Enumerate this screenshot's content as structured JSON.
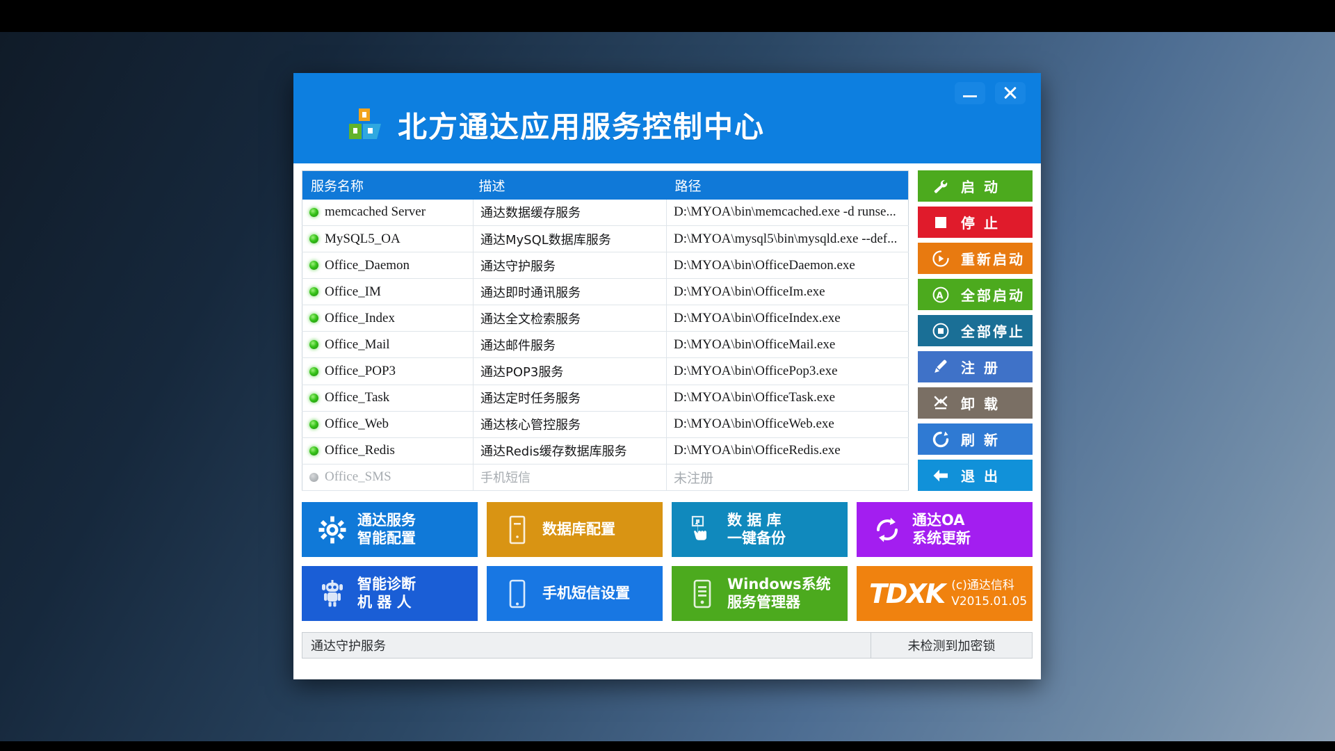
{
  "window": {
    "title": "北方通达应用服务控制中心",
    "logo_icon": "app-blocks-logo",
    "minimize_icon": "minimize-icon",
    "close_icon": "close-icon",
    "titlebar_color": "#0d7fe0"
  },
  "table": {
    "columns": [
      "服务名称",
      "描述",
      "路径"
    ],
    "rows": [
      {
        "status_icon": "status-led-on",
        "name": "memcached Server",
        "desc": "通达数据缓存服务",
        "path": "D:\\MYOA\\bin\\memcached.exe -d runse...",
        "enabled": true
      },
      {
        "status_icon": "status-led-on",
        "name": "MySQL5_OA",
        "desc": "通达MySQL数据库服务",
        "path": "D:\\MYOA\\mysql5\\bin\\mysqld.exe --def...",
        "enabled": true
      },
      {
        "status_icon": "status-led-on",
        "name": "Office_Daemon",
        "desc": "通达守护服务",
        "path": "D:\\MYOA\\bin\\OfficeDaemon.exe",
        "enabled": true
      },
      {
        "status_icon": "status-led-on",
        "name": "Office_IM",
        "desc": "通达即时通讯服务",
        "path": "D:\\MYOA\\bin\\OfficeIm.exe",
        "enabled": true
      },
      {
        "status_icon": "status-led-on",
        "name": "Office_Index",
        "desc": "通达全文检索服务",
        "path": "D:\\MYOA\\bin\\OfficeIndex.exe",
        "enabled": true
      },
      {
        "status_icon": "status-led-on",
        "name": "Office_Mail",
        "desc": "通达邮件服务",
        "path": "D:\\MYOA\\bin\\OfficeMail.exe",
        "enabled": true
      },
      {
        "status_icon": "status-led-on",
        "name": "Office_POP3",
        "desc": "通达POP3服务",
        "path": "D:\\MYOA\\bin\\OfficePop3.exe",
        "enabled": true
      },
      {
        "status_icon": "status-led-on",
        "name": "Office_Task",
        "desc": "通达定时任务服务",
        "path": "D:\\MYOA\\bin\\OfficeTask.exe",
        "enabled": true
      },
      {
        "status_icon": "status-led-on",
        "name": "Office_Web",
        "desc": "通达核心管控服务",
        "path": "D:\\MYOA\\bin\\OfficeWeb.exe",
        "enabled": true
      },
      {
        "status_icon": "status-led-on",
        "name": "Office_Redis",
        "desc": "通达Redis缓存数据库服务",
        "path": "D:\\MYOA\\bin\\OfficeRedis.exe",
        "enabled": true
      },
      {
        "status_icon": "status-led-off",
        "name": "Office_SMS",
        "desc": "手机短信",
        "path": "未注册",
        "enabled": false
      }
    ]
  },
  "actions": [
    {
      "label": "启 动",
      "icon": "wrench-icon",
      "color": "#4caa1e",
      "name": "start-button"
    },
    {
      "label": "停 止",
      "icon": "stop-square-icon",
      "color": "#e01b2b",
      "name": "stop-button"
    },
    {
      "label": "重新启动",
      "icon": "restart-circle-icon",
      "color": "#e87a10",
      "name": "restart-button"
    },
    {
      "label": "全部启动",
      "icon": "start-all-a-icon",
      "color": "#4caa1e",
      "name": "start-all-button"
    },
    {
      "label": "全部停止",
      "icon": "stop-all-circle-icon",
      "color": "#1a6f96",
      "name": "stop-all-button"
    },
    {
      "label": "注 册",
      "icon": "pen-icon",
      "color": "#3f72c8",
      "name": "register-button"
    },
    {
      "label": "卸 载",
      "icon": "x-uninstall-icon",
      "color": "#7a6f64",
      "name": "uninstall-button"
    },
    {
      "label": "刷 新",
      "icon": "refresh-icon",
      "color": "#2f7ad3",
      "name": "refresh-button"
    },
    {
      "label": "退 出",
      "icon": "arrow-left-icon",
      "color": "#1191d9",
      "name": "exit-button"
    }
  ],
  "tiles": [
    {
      "line1": "通达服务",
      "line2": "智能配置",
      "icon": "gear-icon",
      "color": "#1079d8",
      "spaced": false,
      "name": "tile-smart-config"
    },
    {
      "line1": "数据库配置",
      "line2": "",
      "icon": "db-server-icon",
      "color": "#d99413",
      "spaced": false,
      "name": "tile-db-config"
    },
    {
      "line1": "数 据 库",
      "line2": "一键备份",
      "icon": "hand-click-icon",
      "color": "#1089bd",
      "spaced": false,
      "name": "tile-db-backup"
    },
    {
      "line1": "通达OA",
      "line2": "系统更新",
      "icon": "sync-icon",
      "color": "#a31ef0",
      "spaced": false,
      "name": "tile-oa-update"
    },
    {
      "line1": "智能诊断",
      "line2": "机 器 人",
      "icon": "robot-icon",
      "color": "#1a5ed6",
      "spaced": false,
      "name": "tile-diagnostic-robot"
    },
    {
      "line1": "手机短信设置",
      "line2": "",
      "icon": "phone-icon",
      "color": "#1877e3",
      "spaced": false,
      "name": "tile-sms-settings"
    },
    {
      "line1": "Windows系统",
      "line2": "服务管理器",
      "icon": "services-icon",
      "color": "#4caa1e",
      "spaced": false,
      "name": "tile-windows-services"
    }
  ],
  "brand": {
    "mark": "TDXK",
    "copyright": "(c)通达信科",
    "version": "V2015.01.05",
    "color": "#f0820f"
  },
  "statusbar": {
    "left": "通达守护服务",
    "right": "未检测到加密锁"
  }
}
